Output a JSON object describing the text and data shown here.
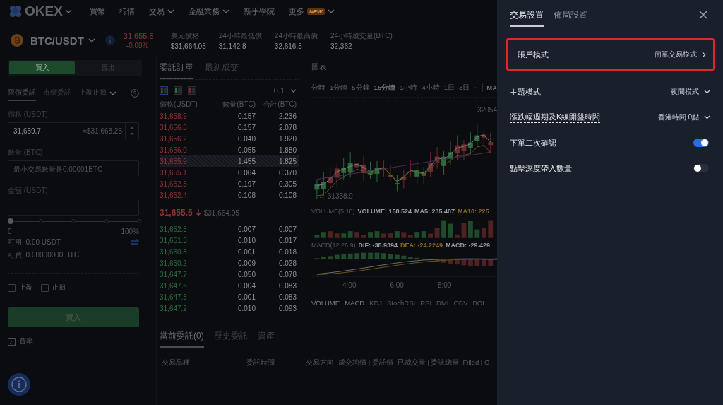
{
  "nav": {
    "logo": "OKEX",
    "items": [
      {
        "label": "買幣",
        "dropdown": false
      },
      {
        "label": "行情",
        "dropdown": false
      },
      {
        "label": "交易",
        "dropdown": true
      },
      {
        "label": "金融業務",
        "dropdown": true
      },
      {
        "label": "新手學院",
        "dropdown": false
      },
      {
        "label": "更多",
        "dropdown": true,
        "badge": "NEW"
      }
    ]
  },
  "ticker": {
    "pair": "BTC/USDT",
    "price": "31,655.5",
    "change": "-0.08%",
    "stats": [
      {
        "label": "美元價格",
        "value": "$31,664.05"
      },
      {
        "label": "24小時最低價",
        "value": "31,142.8"
      },
      {
        "label": "24小時最高價",
        "value": "32,616.8"
      },
      {
        "label": "24小時成交量(BTC)",
        "value": "32,362"
      }
    ]
  },
  "order_form": {
    "sides": [
      {
        "label": "買入",
        "selected": true
      },
      {
        "label": "賣出",
        "selected": false
      }
    ],
    "order_types": [
      {
        "label": "限價委託",
        "selected": true,
        "dropdown": false
      },
      {
        "label": "市價委託",
        "selected": false,
        "dropdown": false
      },
      {
        "label": "止盈止損",
        "selected": false,
        "dropdown": true
      }
    ],
    "price": {
      "label": "價格 (USDT)",
      "value": "31,659.7",
      "hint": "≈$31,668.25"
    },
    "amount": {
      "label": "數量 (BTC)",
      "placeholder": "最小交易數量是0.00001BTC"
    },
    "total": {
      "label": "金額 (USDT)"
    },
    "slider": {
      "level": 0,
      "min_label": "0",
      "max_label": "100%"
    },
    "available": "可用: 0.00 USDT",
    "can_buy": "可買: 0.00000000 BTC",
    "checkboxes": [
      {
        "label": "止盈",
        "checked": false
      },
      {
        "label": "止損",
        "checked": false
      }
    ],
    "submit": "買入",
    "fee": "費率"
  },
  "orderbook": {
    "tabs": [
      {
        "label": "委託訂單",
        "selected": true
      },
      {
        "label": "最新成交",
        "selected": false
      }
    ],
    "views": [
      {
        "kind": "both",
        "selected": true
      },
      {
        "kind": "bids",
        "selected": false
      },
      {
        "kind": "asks",
        "selected": false
      }
    ],
    "precision": "0.1",
    "columns": [
      "價格(USDT)",
      "數量(BTC)",
      "合計(BTC)"
    ],
    "asks": [
      {
        "price": "31,658.9",
        "amount": "0.157",
        "total": "2.236",
        "highlighted": false
      },
      {
        "price": "31,656.8",
        "amount": "0.157",
        "total": "2.078",
        "highlighted": false
      },
      {
        "price": "31,656.2",
        "amount": "0.040",
        "total": "1.920",
        "highlighted": false
      },
      {
        "price": "31,656.0",
        "amount": "0.055",
        "total": "1.880",
        "highlighted": false
      },
      {
        "price": "31,655.9",
        "amount": "1.455",
        "total": "1.825",
        "highlighted": true
      },
      {
        "price": "31,655.1",
        "amount": "0.064",
        "total": "0.370",
        "highlighted": false
      },
      {
        "price": "31,652.5",
        "amount": "0.197",
        "total": "0.305",
        "highlighted": false
      },
      {
        "price": "31,652.4",
        "amount": "0.108",
        "total": "0.108",
        "highlighted": false
      }
    ],
    "last": {
      "price": "31,655.5",
      "usd": "$31,664.05"
    },
    "bids": [
      {
        "price": "31,652.3",
        "amount": "0.007",
        "total": "0.007",
        "highlighted": false
      },
      {
        "price": "31,651.3",
        "amount": "0.010",
        "total": "0.017",
        "highlighted": false
      },
      {
        "price": "31,650.3",
        "amount": "0.001",
        "total": "0.018",
        "highlighted": false
      },
      {
        "price": "31,650.2",
        "amount": "0.009",
        "total": "0.028",
        "highlighted": false
      },
      {
        "price": "31,647.7",
        "amount": "0.050",
        "total": "0.078",
        "highlighted": false
      },
      {
        "price": "31,647.6",
        "amount": "0.004",
        "total": "0.083",
        "highlighted": false
      },
      {
        "price": "31,647.3",
        "amount": "0.001",
        "total": "0.083",
        "highlighted": false
      },
      {
        "price": "31,647.2",
        "amount": "0.010",
        "total": "0.093",
        "highlighted": false
      }
    ]
  },
  "chart": {
    "title": "圖表",
    "intervals": [
      {
        "label": "分時",
        "selected": false
      },
      {
        "label": "1分鐘",
        "selected": false
      },
      {
        "label": "5分鐘",
        "selected": false
      },
      {
        "label": "15分鐘",
        "selected": true
      },
      {
        "label": "1小時",
        "selected": false
      },
      {
        "label": "4小時",
        "selected": false
      },
      {
        "label": "1日",
        "selected": false
      },
      {
        "label": "3日",
        "selected": false
      }
    ],
    "indicator_menu": "MA",
    "high_label": "32054",
    "low_label": "← 31338.9",
    "volume": {
      "name": "VOLUME(5,10)",
      "values": [
        {
          "text": "VOLUME: 158.524",
          "color": "#9a9ca2"
        },
        {
          "text": "MA5: 235.407",
          "color": "#9a9ca2"
        },
        {
          "text": "MA10: 225",
          "color": "#8a6a1e"
        }
      ]
    },
    "macd": {
      "name": "MACD(12,26,9)",
      "values": [
        {
          "text": "DIF: -38.9394",
          "color": "#9a9ca2"
        },
        {
          "text": "DEA: -24.2249",
          "color": "#8a6a1e"
        },
        {
          "text": "MACD: -29.429",
          "color": "#9a9ca2"
        }
      ]
    },
    "times": [
      "4:00",
      "6:00",
      "8:00"
    ],
    "indicators": [
      {
        "label": "VOLUME",
        "selected": true
      },
      {
        "label": "MACD",
        "selected": true
      },
      {
        "label": "KDJ",
        "selected": false
      },
      {
        "label": "StochRSI",
        "selected": false
      },
      {
        "label": "RSI",
        "selected": false
      },
      {
        "label": "DMI",
        "selected": false
      },
      {
        "label": "OBV",
        "selected": false
      },
      {
        "label": "BOL",
        "selected": false
      }
    ]
  },
  "orders": {
    "tabs": [
      {
        "label": "當前委託(0)",
        "selected": true
      },
      {
        "label": "歷史委託",
        "selected": false
      },
      {
        "label": "資產",
        "selected": false
      }
    ],
    "columns": [
      "交易品種",
      "委託時間",
      "交易方向",
      "成交均價 | 委託價",
      "已成交量 | 委託總量",
      "Filled | O"
    ]
  },
  "settings": {
    "tabs": [
      {
        "label": "交易設置",
        "selected": true
      },
      {
        "label": "佈局設置",
        "selected": false
      }
    ],
    "rows": [
      {
        "kind": "link",
        "label": "賬戶模式",
        "value": "簡單交易模式",
        "highlighted": true
      },
      {
        "kind": "select",
        "label": "主題模式",
        "value": "夜間模式",
        "underlined": false
      },
      {
        "kind": "select",
        "label": "漲跌幅週期及K線開盤時間",
        "value": "香港時間 0點",
        "underlined": true
      },
      {
        "kind": "toggle",
        "label": "下單二次確認",
        "on": true
      },
      {
        "kind": "toggle",
        "label": "點擊深度帶入數量",
        "on": false
      }
    ]
  }
}
